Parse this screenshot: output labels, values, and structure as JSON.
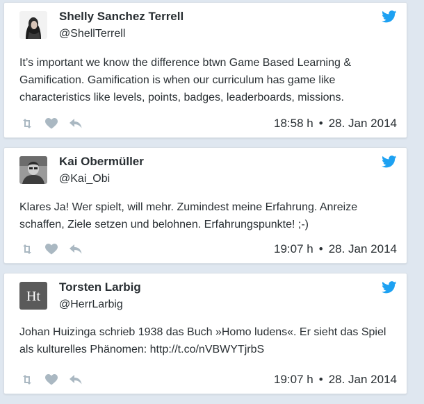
{
  "colors": {
    "background": "#dfe7f0",
    "card": "#ffffff",
    "text": "#292f33",
    "twitter_blue": "#1da1f2",
    "action_gray": "#aab8c2"
  },
  "tweets": [
    {
      "name": "Shelly Sanchez Terrell",
      "handle": "@ShellTerrell",
      "text": "It’s important we know the difference btwn Game Based Learning & Gamification. Gamification is when our curriculum has game like characteristics like levels, points, badges, leaderboards, missions.",
      "time": "18:58 h",
      "date": "28. Jan 2014",
      "icons": [
        "twitter-bird-icon",
        "retweet-icon",
        "heart-icon",
        "reply-icon"
      ]
    },
    {
      "name": "Kai Obermüller",
      "handle": "@Kai_Obi",
      "text": "Klares Ja! Wer spielt, will mehr. Zumindest meine Erfahrung. Anreize schaffen, Ziele setzen und belohnen. Erfahrungspunkte! ;-)",
      "time": "19:07 h",
      "date": "28. Jan 2014",
      "icons": [
        "twitter-bird-icon",
        "retweet-icon",
        "heart-icon",
        "reply-icon"
      ]
    },
    {
      "name": "Torsten Larbig",
      "handle": "@HerrLarbig",
      "avatar_logo": "Ht",
      "text": "Johan Huizinga schrieb 1938 das Buch »Homo ludens«. Er sieht das Spiel als kulturelles Phänomen: http://t.co/nVBWYTjrbS",
      "time": "19:07 h",
      "date": "28. Jan 2014",
      "icons": [
        "twitter-bird-icon",
        "retweet-icon",
        "heart-icon",
        "reply-icon"
      ]
    }
  ]
}
